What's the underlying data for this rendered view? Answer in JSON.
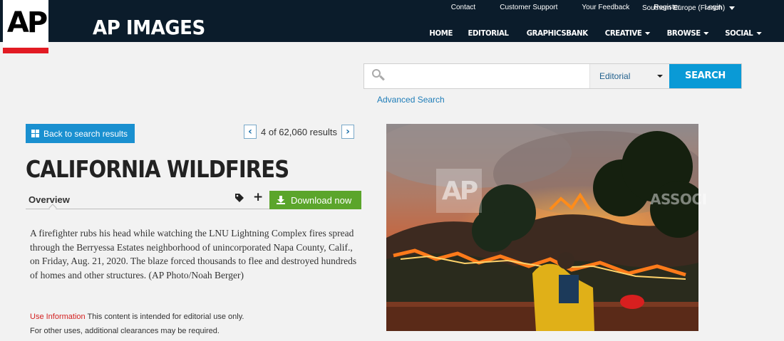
{
  "header": {
    "logo": "AP",
    "site_name": "AP IMAGES",
    "util_links": [
      "Contact",
      "Customer Support",
      "Your Feedback",
      "Register",
      "Login"
    ],
    "region": "Southern Europe (French)",
    "main_nav": [
      {
        "label": "HOME",
        "dropdown": false
      },
      {
        "label": "EDITORIAL",
        "dropdown": false
      },
      {
        "label": "GRAPHICSBANK",
        "dropdown": false
      },
      {
        "label": "CREATIVE",
        "dropdown": true
      },
      {
        "label": "BROWSE",
        "dropdown": true
      },
      {
        "label": "SOCIAL",
        "dropdown": true
      }
    ]
  },
  "search": {
    "placeholder": "",
    "value": "",
    "scope": "Editorial",
    "button": "SEARCH",
    "advanced": "Advanced Search"
  },
  "nav": {
    "back": "Back to search results",
    "position": "4 of 62,060 results"
  },
  "detail": {
    "title": "CALIFORNIA WILDFIRES",
    "tab": "Overview",
    "download": "Download now",
    "caption": "A firefighter rubs his head while watching the LNU Lightning Complex fires spread through the Berryessa Estates neighborhood of unincorporated Napa County, Calif., on Friday, Aug. 21, 2020. The blaze forced thousands to flee and destroyed hundreds of homes and other structures. (AP Photo/Noah Berger)",
    "use_info_label": "Use Information",
    "use_info_text": " This content is intended for editorial use only.",
    "use_info_text2": "For other uses, additional clearances may be required."
  },
  "photo": {
    "watermark_logo": "AP",
    "watermark_text": "ASSOCI"
  },
  "colors": {
    "header_bg": "#0b1c2b",
    "accent_red": "#e21b23",
    "button_blue": "#0a9ad6",
    "download_green": "#5ba52b"
  }
}
